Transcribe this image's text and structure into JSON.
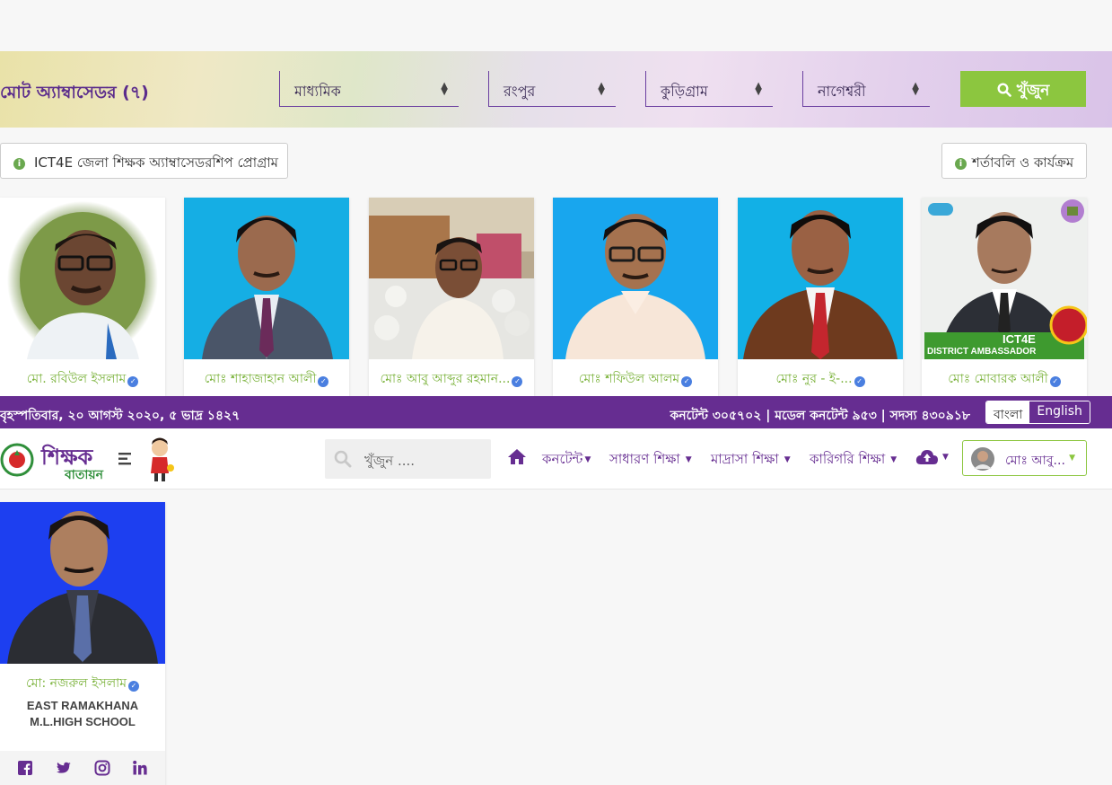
{
  "filter_bar": {
    "title": "মোট অ্যাম্বাসেডর (৭)",
    "selects": [
      {
        "value": "মাধ্যমিক"
      },
      {
        "value": "রংপুর"
      },
      {
        "value": "কুড়িগ্রাম"
      },
      {
        "value": "নাগেশ্বরী"
      }
    ],
    "search_label": "খুঁজুন"
  },
  "info_buttons": {
    "program": "ICT4E জেলা শিক্ষক অ্যাম্বাসেডরশিপ প্রোগ্রাম",
    "terms": "শর্তাবলি ও কার্যক্রম"
  },
  "ambassadors": [
    {
      "name": "মো. রবিউল ইসলাম"
    },
    {
      "name": "মোঃ শাহাজাহান আলী"
    },
    {
      "name": "মোঃ আবু আব্দুর রহমান..."
    },
    {
      "name": "মোঃ শফিউল আলম"
    },
    {
      "name": "মোঃ নুর - ই-..."
    },
    {
      "name": "মোঃ মোবারক আলী"
    }
  ],
  "ambassador_badge": {
    "line1": "ICT4E",
    "line2": "DISTRICT AMBASSADOR"
  },
  "status_bar": {
    "date": "বৃহস্পতিবার, ২০ আগস্ট ২০২০, ৫ ভাদ্র ১৪২৭",
    "stats": "কনটেন্ট ৩০৫৭০২ | মডেল কনটেন্ট ৯৫৩ | সদস্য ৪৩০৯১৮",
    "lang_bn": "বাংলা",
    "lang_en": "English"
  },
  "navbar": {
    "logo_line1": "শিক্ষক",
    "logo_line2": "বাতায়ন",
    "search_placeholder": "খুঁজুন ....",
    "menu": [
      "কনটেন্ট",
      "সাধারণ শিক্ষা",
      "মাদ্রাসা শিক্ষা",
      "কারিগরি শিক্ষা"
    ],
    "user_name": "মোঃ আবু..."
  },
  "featured_teacher": {
    "name": "মো: নজরুল ইসলাম",
    "school_line1": "EAST RAMAKHANA",
    "school_line2": "M.L.HIGH SCHOOL"
  },
  "colors": {
    "brand_purple": "#662d91",
    "accent_green": "#8cc63f",
    "name_green": "#7ab23a",
    "verified_blue": "#4a7fe0"
  }
}
